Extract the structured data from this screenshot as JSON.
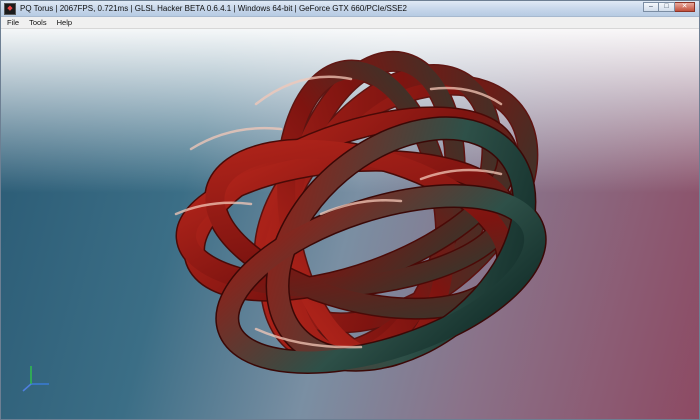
{
  "window": {
    "title": "PQ Torus | 2067FPS, 0.721ms | GLSL Hacker BETA 0.6.4.1 | Windows 64-bit | GeForce GTX 660/PCIe/SSE2",
    "controls": {
      "minimize": "–",
      "maximize": "□",
      "close": "✕"
    }
  },
  "menu": {
    "items": [
      {
        "label": "File"
      },
      {
        "label": "Tools"
      },
      {
        "label": "Help"
      }
    ]
  },
  "scene": {
    "object": "pq-torus-knot",
    "tube_color": "#8e1610",
    "highlight_color": "#1f5a50",
    "background_top": "#ffffff",
    "background_left": "#2a5a74",
    "background_right": "#8d4a63",
    "axis_colors": {
      "x": "#3a7bd5",
      "y": "#2fbf4a",
      "z": "#4f7fe0"
    }
  }
}
